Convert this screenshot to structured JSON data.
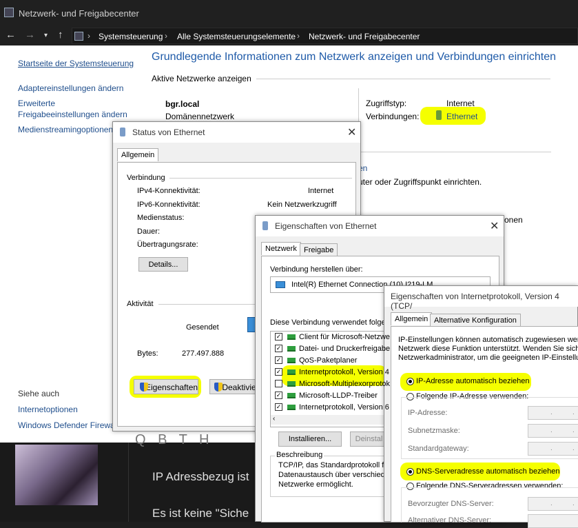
{
  "window": {
    "title": "Netzwerk- und Freigabecenter"
  },
  "address": {
    "crumbs": [
      "Systemsteuerung",
      "Alle Systemsteuerungselemente",
      "Netzwerk- und Freigabecenter"
    ]
  },
  "sidebar": {
    "home": "Startseite der Systemsteuerung",
    "links": [
      "Adaptereinstellungen ändern",
      "Erweiterte",
      "Freigabeeinstellungen ändern",
      "Medienstreamingoptionen"
    ],
    "see_also_title": "Siehe auch",
    "see_also": [
      "Internetoptionen",
      "Windows Defender Firewall"
    ]
  },
  "main": {
    "title": "Grundlegende Informationen zum Netzwerk anzeigen und Verbindungen einrichten",
    "active_networks": "Aktive Netzwerke anzeigen",
    "network_name": "bgr.local",
    "network_type": "Domänennetzwerk",
    "access_label": "Zugriffstyp:",
    "access_value": "Internet",
    "conn_label": "Verbindungen:",
    "conn_value": "Ethernet",
    "frag_link": "en",
    "frag1": "uter oder Zugriffspunkt einrichten.",
    "frag2": "onen"
  },
  "web": {
    "line1": "IP Adressbezug ist",
    "line2": "Es ist keine \"Siche",
    "glyphs": "Q  B  T  H"
  },
  "status_dialog": {
    "title": "Status von Ethernet",
    "tab": "Allgemein",
    "section_conn": "Verbindung",
    "rows": [
      {
        "label": "IPv4-Konnektivität:",
        "value": "Internet"
      },
      {
        "label": "IPv6-Konnektivität:",
        "value": "Kein Netzwerkzugriff"
      },
      {
        "label": "Medienstatus:",
        "value": ""
      },
      {
        "label": "Dauer:",
        "value": ""
      },
      {
        "label": "Übertragungsrate:",
        "value": ""
      }
    ],
    "details": "Details...",
    "section_act": "Aktivität",
    "sent": "Gesendet",
    "bytes_label": "Bytes:",
    "bytes_value": "277.497.888",
    "props_btn": "Eigenschaften",
    "disable_btn": "Deaktivie"
  },
  "props_dialog": {
    "title": "Eigenschaften von Ethernet",
    "tabs": [
      "Netzwerk",
      "Freigabe"
    ],
    "connect_via": "Verbindung herstellen über:",
    "adapter": "Intel(R) Ethernet Connection (10) I219-LM",
    "uses": "Diese Verbindung verwendet folgen",
    "items": [
      {
        "label": "Client für Microsoft-Netzwe",
        "checked": true
      },
      {
        "label": "Datei- und Druckerfreigabe",
        "checked": true
      },
      {
        "label": "QoS-Paketplaner",
        "checked": true
      },
      {
        "label": "Internetprotokoll, Version 4",
        "checked": true
      },
      {
        "label": "Microsoft-Multiplexorprotok",
        "checked": false
      },
      {
        "label": "Microsoft-LLDP-Treiber",
        "checked": true
      },
      {
        "label": "Internetprotokoll, Version 6",
        "checked": true
      }
    ],
    "install_btn": "Installieren...",
    "uninstall_btn": "Deinstal",
    "desc_title": "Beschreibung",
    "desc": [
      "TCP/IP, das Standardprotokoll für",
      "Datenaustausch über verschiede",
      "Netzwerke ermöglicht."
    ]
  },
  "ipv4_dialog": {
    "title": "Eigenschaften von Internetprotokoll, Version 4 (TCP/",
    "tabs": [
      "Allgemein",
      "Alternative Konfiguration"
    ],
    "intro": [
      "IP-Einstellungen können automatisch zugewiesen werd",
      "Netzwerk diese Funktion unterstützt. Wenden Sie sich",
      "Netzwerkadministrator, um die geeigneten IP-Einstellun"
    ],
    "ip_auto": "IP-Adresse automatisch beziehen",
    "ip_manual": "Folgende IP-Adresse verwenden:",
    "ip_fields": [
      "IP-Adresse:",
      "Subnetzmaske:",
      "Standardgateway:"
    ],
    "dns_auto": "DNS-Serveradresse automatisch beziehen",
    "dns_manual": "Folgende DNS-Serveradressen verwenden:",
    "dns_fields": [
      "Bevorzugter DNS-Server:",
      "Alternativer DNS-Server:"
    ]
  },
  "colors": {
    "highlight": "#f5ff00",
    "link": "#1f4e8c",
    "title_blue": "#1e5aa8"
  }
}
